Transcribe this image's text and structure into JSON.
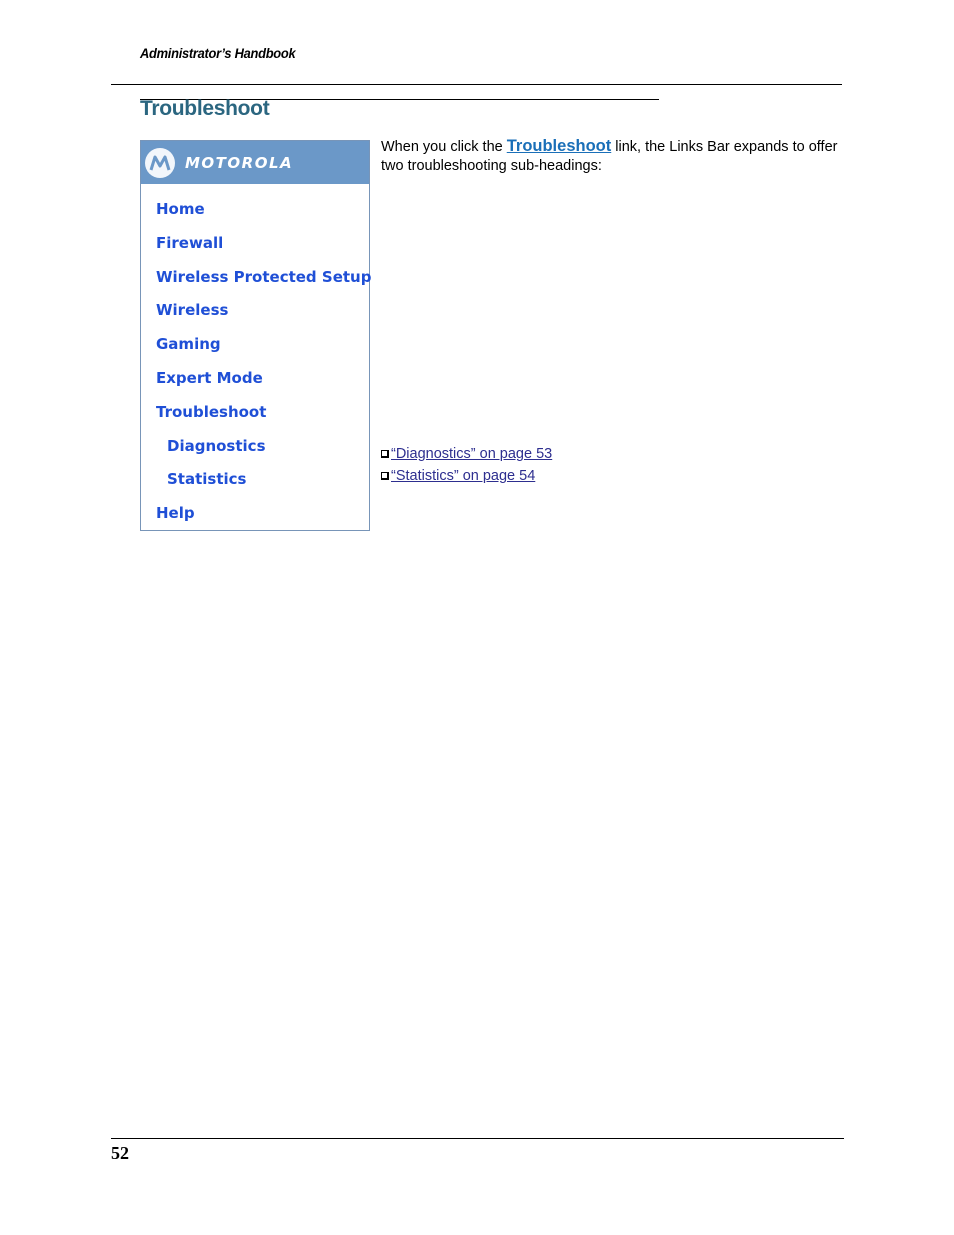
{
  "header": {
    "running_title": "Administrator’s Handbook"
  },
  "section": {
    "title": "Troubleshoot"
  },
  "links_bar": {
    "brand": "MOTOROLA",
    "logo_icon": "motorola-batwing-icon",
    "items": [
      {
        "label": "Home",
        "level": 0
      },
      {
        "label": "Firewall",
        "level": 0
      },
      {
        "label": "Wireless Protected Setup",
        "level": 0
      },
      {
        "label": "Wireless",
        "level": 0
      },
      {
        "label": "Gaming",
        "level": 0
      },
      {
        "label": "Expert Mode",
        "level": 0
      },
      {
        "label": "Troubleshoot",
        "level": 0
      },
      {
        "label": "Diagnostics",
        "level": 1
      },
      {
        "label": "Statistics",
        "level": 1
      },
      {
        "label": "Help",
        "level": 0
      }
    ]
  },
  "body": {
    "text_before": "When you click the ",
    "inline_link": "Troubleshoot",
    "text_after": " link, the Links Bar expands to offer two troubleshooting sub-headings:"
  },
  "xrefs": [
    {
      "label": "“Diagnostics” on page 53"
    },
    {
      "label": "“Statistics” on page 54"
    }
  ],
  "footer": {
    "page_number": "52"
  }
}
